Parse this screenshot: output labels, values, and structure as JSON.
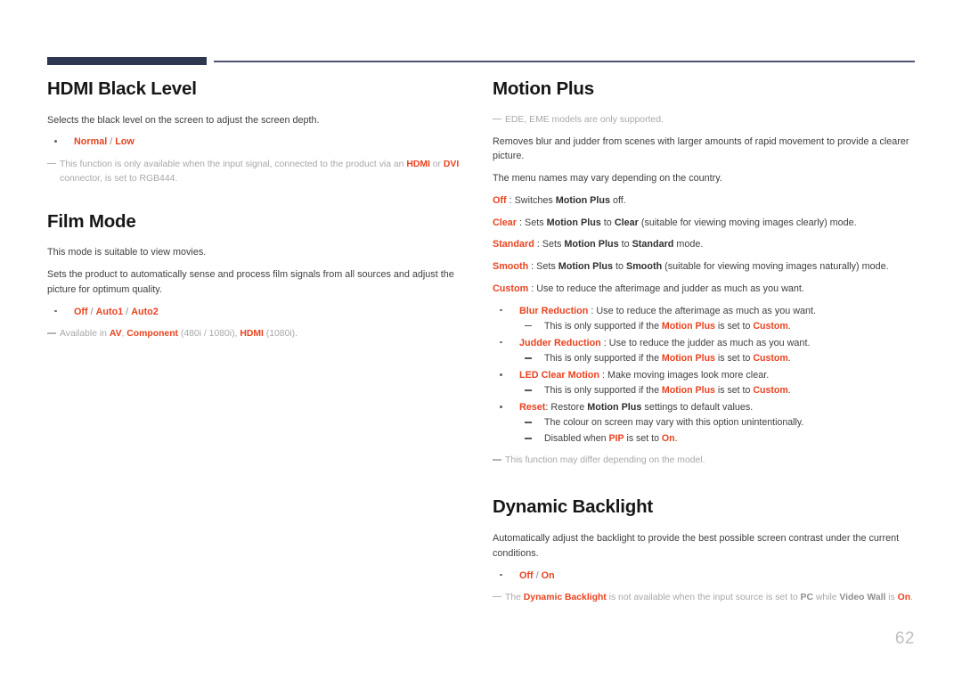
{
  "page": {
    "number": "62",
    "accent_red": "#e9431f",
    "header_bar_color": "#2e3650",
    "header_line_color": "#4e5370"
  },
  "left_column": {
    "sections": [
      {
        "title": "HDMI Black Level",
        "intro": "Selects the black level on the screen to adjust the screen depth.",
        "bullet": {
          "opt1": "Normal",
          "sep": " / ",
          "opt2": "Low"
        },
        "note": {
          "t1": "This function is only available when the input signal, connected to the product via an ",
          "k1": "HDMI",
          "t2": " or ",
          "k2": "DVI",
          "t3": " connector, is set to RGB444."
        }
      },
      {
        "title": "Film Mode",
        "intro1": "This mode is suitable to view movies.",
        "intro2": "Sets the product to automatically sense and process film signals from all sources and adjust the picture for optimum quality.",
        "bullet": {
          "opt1": "Off",
          "sep1": " / ",
          "opt2": "Auto1",
          "sep2": " / ",
          "opt3": "Auto2"
        },
        "note": {
          "t1": "Available in ",
          "k1": "AV",
          "t2": ", ",
          "k2": "Component",
          "t3": " (480i / 1080i), ",
          "k3": "HDMI",
          "t4": " (1080i)."
        }
      }
    ]
  },
  "right_column": {
    "sections": [
      {
        "title": "Motion Plus",
        "top_note": "EDE, EME models are only supported.",
        "intro1": "Removes blur and judder from scenes with larger amounts of rapid movement to provide a clearer picture.",
        "intro2": "The menu names may vary depending on the country.",
        "options": [
          {
            "key": "Off",
            "mid1": " : Switches ",
            "ref": "Motion Plus",
            "mid2": " off.",
            "val": "",
            "tail": ""
          },
          {
            "key": "Clear",
            "mid1": " : Sets ",
            "ref": "Motion Plus",
            "mid2": " to ",
            "val": "Clear",
            "tail": " (suitable for viewing moving images clearly) mode."
          },
          {
            "key": "Standard",
            "mid1": " : Sets ",
            "ref": "Motion Plus",
            "mid2": " to ",
            "val": "Standard",
            "tail": " mode."
          },
          {
            "key": "Smooth",
            "mid1": " : Sets ",
            "ref": "Motion Plus",
            "mid2": " to ",
            "val": "Smooth",
            "tail": " (suitable for viewing moving images naturally) mode."
          },
          {
            "key": "Custom",
            "mid1": " : Use to reduce the afterimage and judder as much as you want.",
            "ref": "",
            "mid2": "",
            "val": "",
            "tail": ""
          }
        ],
        "bullets": [
          {
            "key": "Blur Reduction",
            "text": " : Use to reduce the afterimage as much as you want.",
            "subs": [
              {
                "t1": "This is only supported if the ",
                "k1": "Motion Plus",
                "t2": " is set to ",
                "k2": "Custom",
                "t3": "."
              }
            ]
          },
          {
            "key": "Judder Reduction",
            "text": " : Use to reduce the judder as much as you want.",
            "subs": [
              {
                "t1": "This is only supported if the ",
                "k1": "Motion Plus",
                "t2": " is set to ",
                "k2": "Custom",
                "t3": "."
              }
            ]
          },
          {
            "key": "LED Clear Motion",
            "text": " : Make moving images look more clear.",
            "subs": [
              {
                "t1": "This is only supported if the ",
                "k1": "Motion Plus",
                "t2": " is set to ",
                "k2": "Custom",
                "t3": "."
              }
            ]
          },
          {
            "key": "Reset",
            "text": ": Restore ",
            "ref": "Motion Plus",
            "text2": " settings to default values.",
            "subs": [
              {
                "t1": "The colour on screen may vary with this option unintentionally.",
                "k1": "",
                "t2": "",
                "k2": "",
                "t3": ""
              },
              {
                "t1": "Disabled when ",
                "k1": "PIP",
                "t2": " is set to ",
                "k2": "On",
                "t3": "."
              }
            ]
          }
        ],
        "bottom_note": "This function may differ depending on the model."
      },
      {
        "title": "Dynamic Backlight",
        "intro": "Automatically adjust the backlight to provide the best possible screen contrast under the current conditions.",
        "bullet": {
          "opt1": "Off",
          "sep": " / ",
          "opt2": "On"
        },
        "note": {
          "t1": "The ",
          "k1": "Dynamic Backlight",
          "t2": " is not available when the input source is set to ",
          "k2": "PC",
          "t3": " while ",
          "k3": "Video Wall",
          "t4": " is ",
          "k4": "On",
          "t5": "."
        }
      }
    ]
  }
}
